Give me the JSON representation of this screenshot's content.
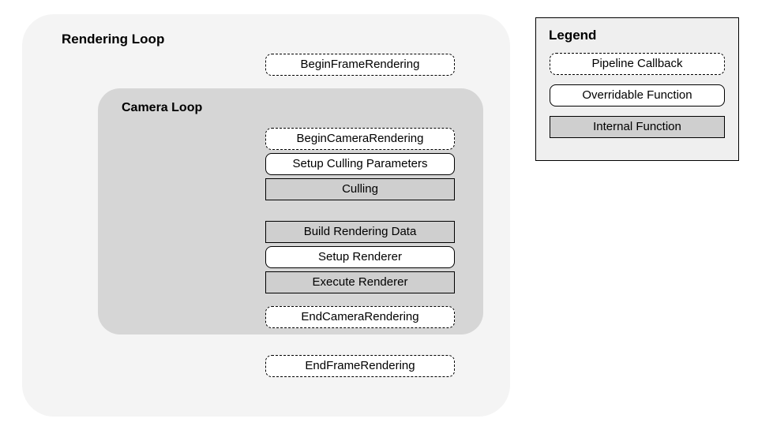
{
  "renderingLoop": {
    "title": "Rendering Loop",
    "begin": "BeginFrameRendering",
    "end": "EndFrameRendering"
  },
  "cameraLoop": {
    "title": "Camera Loop",
    "steps": {
      "beginCamera": "BeginCameraRendering",
      "setupCulling": "Setup Culling Parameters",
      "culling": "Culling",
      "buildData": "Build Rendering Data",
      "setupRenderer": "Setup Renderer",
      "executeRenderer": "Execute Renderer",
      "endCamera": "EndCameraRendering"
    }
  },
  "legend": {
    "title": "Legend",
    "callback": "Pipeline Callback",
    "overridable": "Overridable Function",
    "internal": "Internal Function"
  }
}
